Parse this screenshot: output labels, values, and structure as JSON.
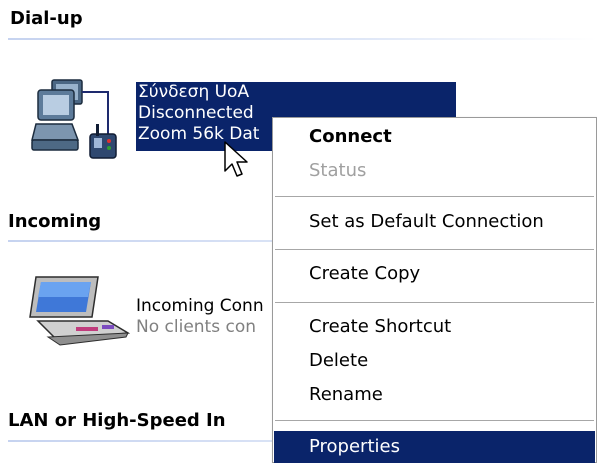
{
  "groups": {
    "dialup": "Dial-up",
    "incoming": "Incoming",
    "lan": "LAN or High-Speed In"
  },
  "dialup_connection": {
    "name": "Σύνδεση UoA",
    "status": "Disconnected",
    "device": "Zoom 56k Dat"
  },
  "incoming_connection": {
    "name": "Incoming Conn",
    "status": "No clients con"
  },
  "context_menu": {
    "connect": "Connect",
    "status": "Status",
    "set_default": "Set as Default Connection",
    "create_copy": "Create Copy",
    "create_shortcut": "Create Shortcut",
    "delete": "Delete",
    "rename": "Rename",
    "properties": "Properties"
  },
  "colors": {
    "selection": "#0a246a",
    "group_rule": "#c6d3f0",
    "disabled_text": "#a0a0a0"
  },
  "icons": {
    "dialup": "network-computers-phone-icon",
    "incoming": "incoming-connection-computer-icon",
    "cursor": "mouse-pointer-icon"
  }
}
